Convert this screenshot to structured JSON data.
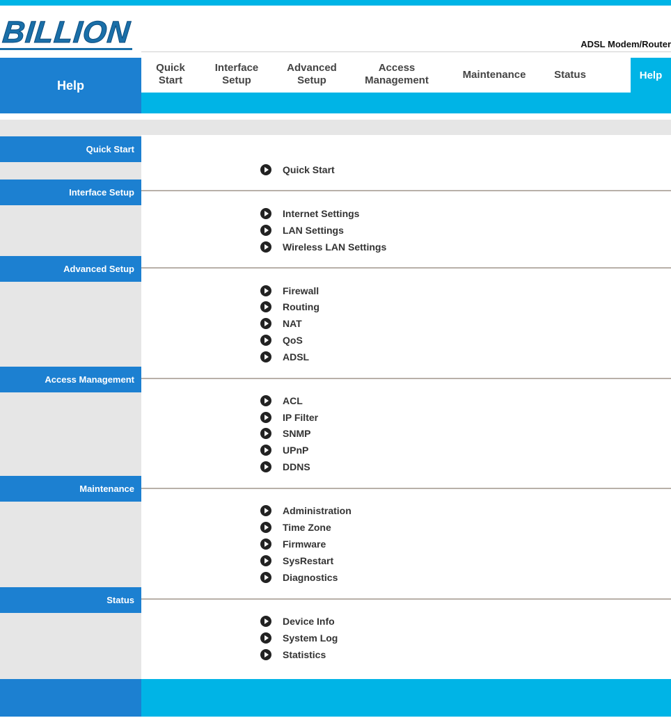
{
  "brand": {
    "logo": "BILLION",
    "product": "ADSL Modem/Router"
  },
  "page_title": "Help",
  "nav": [
    {
      "label": "Quick\nStart"
    },
    {
      "label": "Interface\nSetup"
    },
    {
      "label": "Advanced\nSetup"
    },
    {
      "label": "Access\nManagement"
    },
    {
      "label": "Maintenance"
    },
    {
      "label": "Status"
    },
    {
      "label": "Help"
    }
  ],
  "sections": [
    {
      "title": "Quick Start",
      "links": [
        "Quick Start"
      ]
    },
    {
      "title": "Interface Setup",
      "links": [
        "Internet Settings",
        "LAN Settings",
        "Wireless LAN Settings"
      ]
    },
    {
      "title": "Advanced Setup",
      "links": [
        "Firewall",
        "Routing",
        "NAT",
        "QoS",
        "ADSL"
      ]
    },
    {
      "title": "Access Management",
      "links": [
        "ACL",
        "IP Filter",
        "SNMP",
        "UPnP",
        "DDNS"
      ]
    },
    {
      "title": "Maintenance",
      "links": [
        "Administration",
        "Time Zone",
        "Firmware",
        "SysRestart",
        "Diagnostics"
      ]
    },
    {
      "title": "Status",
      "links": [
        "Device Info",
        "System Log",
        "Statistics"
      ]
    }
  ],
  "colors": {
    "accent_cyan": "#00b4e6",
    "accent_blue": "#1c80d1",
    "panel_grey": "#e6e6e6"
  }
}
